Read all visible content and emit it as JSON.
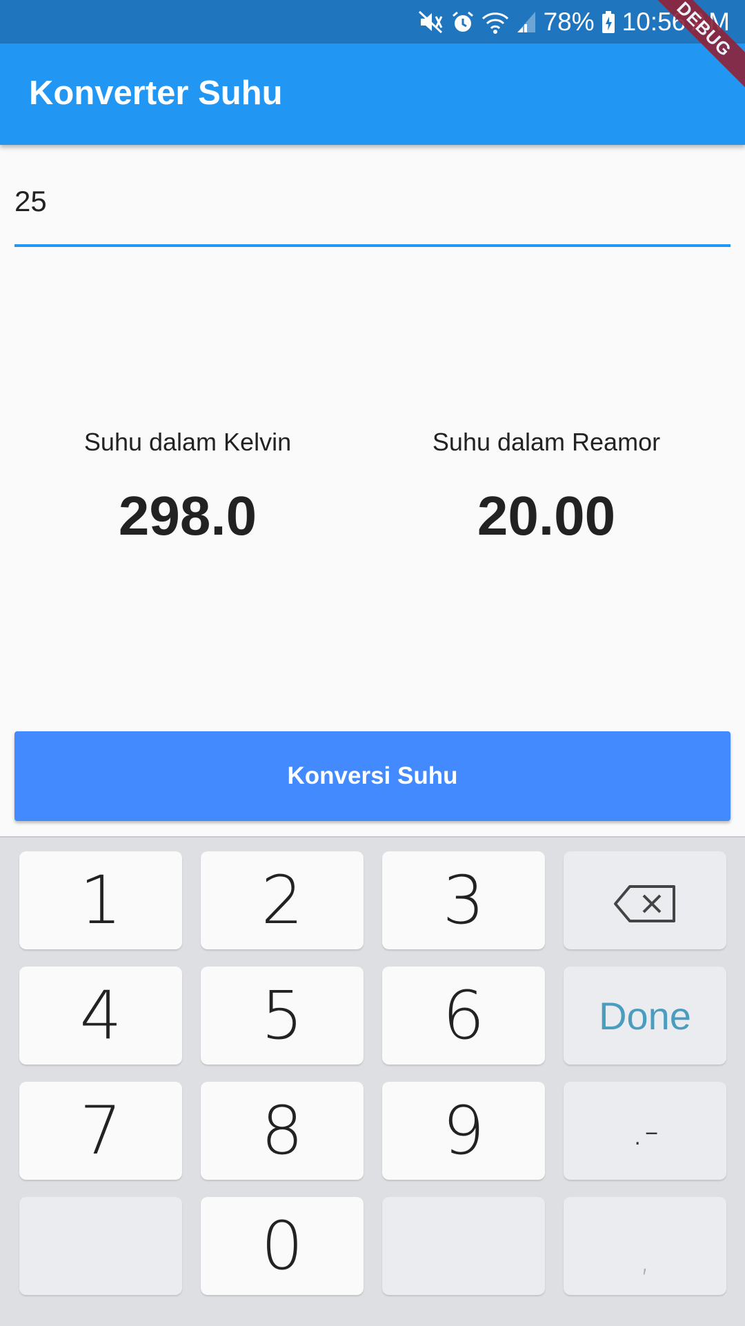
{
  "status_bar": {
    "battery": "78%",
    "time": "10:56 AM",
    "debug_label": "DEBUG",
    "icons": [
      "mute-icon",
      "alarm-icon",
      "wifi-icon",
      "signal-icon",
      "battery-icon"
    ]
  },
  "app_bar": {
    "title": "Konverter Suhu"
  },
  "input": {
    "value": "25"
  },
  "results": {
    "kelvin": {
      "label": "Suhu dalam Kelvin",
      "value": "298.0"
    },
    "reamor": {
      "label": "Suhu dalam Reamor",
      "value": "20.00"
    }
  },
  "button": {
    "label": "Konversi Suhu"
  },
  "keyboard": {
    "keys": {
      "k1": "1",
      "k2": "2",
      "k3": "3",
      "k4": "4",
      "k5": "5",
      "k6": "6",
      "k7": "7",
      "k8": "8",
      "k9": "9",
      "k0": "0",
      "done": "Done",
      "dot_minus": ".-",
      "comma": ","
    },
    "backspace_icon": "backspace-icon"
  },
  "colors": {
    "status_bar": "#1f76bf",
    "app_bar": "#2196f3",
    "button": "#448aff",
    "done_text": "#4a9dbf"
  }
}
